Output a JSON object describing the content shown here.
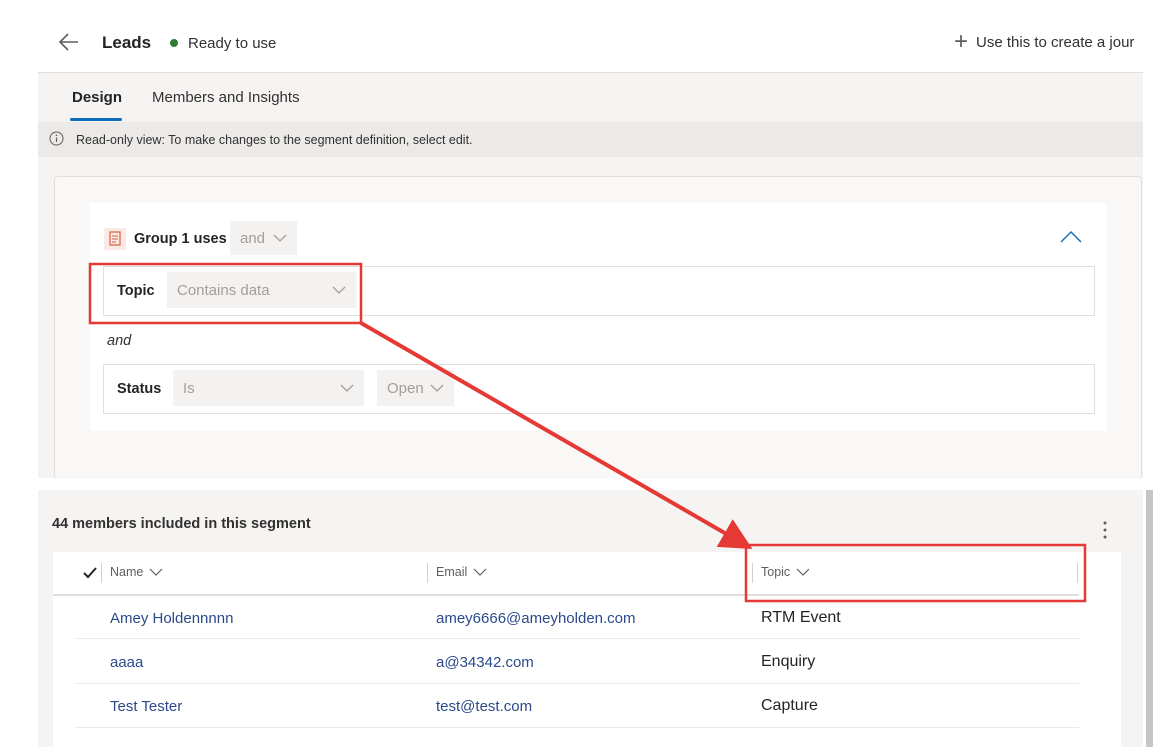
{
  "header": {
    "title": "Leads",
    "status": "Ready to use",
    "create_action": "Use this to create a jour"
  },
  "tabs": [
    {
      "label": "Design",
      "active": true
    },
    {
      "label": "Members and Insights",
      "active": false
    }
  ],
  "info_bar": {
    "text": "Read-only view: To make changes to the segment definition, select edit."
  },
  "segment": {
    "group_label": "Group 1 uses",
    "group_operator": "and",
    "conditions": [
      {
        "field": "Topic",
        "operator": "Contains data",
        "value": ""
      },
      {
        "connector": "and"
      },
      {
        "field": "Status",
        "operator": "Is",
        "value": "Open"
      }
    ]
  },
  "members": {
    "title": "44 members included in this segment",
    "columns": [
      "Name",
      "Email",
      "Topic"
    ],
    "rows": [
      {
        "name": "Amey Holdennnnn",
        "email": "amey6666@ameyholden.com",
        "topic": "RTM Event"
      },
      {
        "name": "aaaa",
        "email": "a@34342.com",
        "topic": "Enquiry"
      },
      {
        "name": "Test Tester",
        "email": "test@test.com",
        "topic": "Capture"
      }
    ]
  },
  "colors": {
    "accent": "#0f6cbd",
    "status_green": "#2e7d32",
    "annotation_red": "#e53935",
    "link": "#2b4a8b"
  },
  "icons": {
    "back": "back-arrow-icon",
    "status": "status-dot-icon",
    "add": "plus-icon",
    "info": "info-icon",
    "group": "group-list-icon",
    "collapse": "chevron-up-icon",
    "more": "more-vertical-icon",
    "select_all": "checkmark-icon"
  }
}
